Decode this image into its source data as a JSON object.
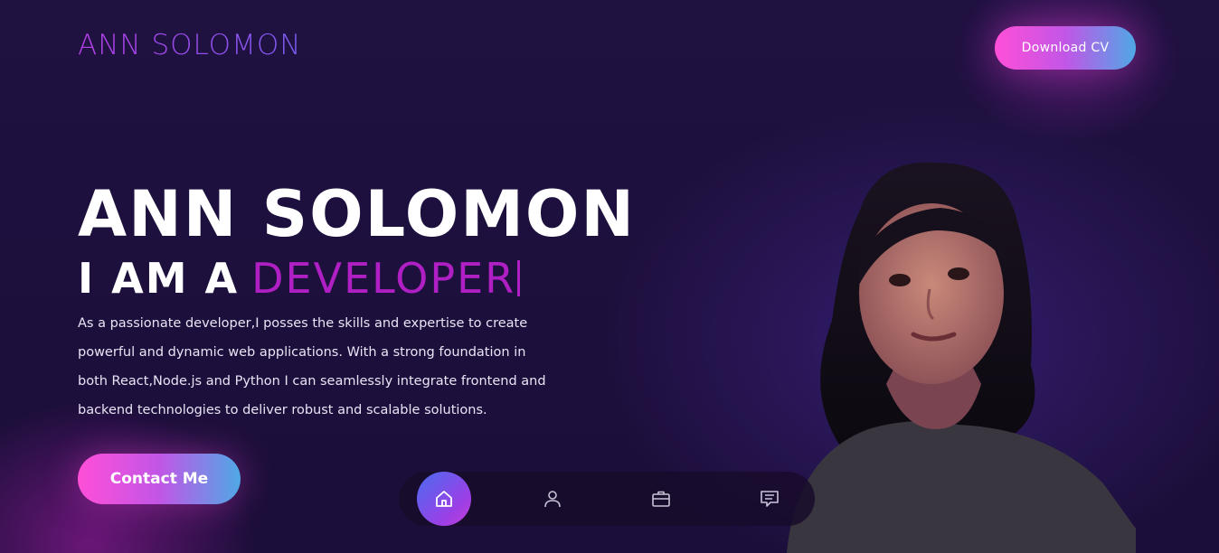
{
  "header": {
    "logo": "ANN SOLOMON",
    "download_label": "Download CV"
  },
  "hero": {
    "name": "ANN SOLOMON",
    "intro": "I AM A",
    "role": "DEVELOPER",
    "description": "As a passionate developer,I posses the skills and expertise to create powerful and dynamic web applications. With a strong foundation in both React,Node.js and Python I can seamlessly integrate frontend and backend technologies to deliver robust and scalable solutions.",
    "contact_label": "Contact Me"
  },
  "bottom_nav": {
    "items": [
      {
        "icon": "home-icon",
        "active": true
      },
      {
        "icon": "user-icon",
        "active": false
      },
      {
        "icon": "briefcase-icon",
        "active": false
      },
      {
        "icon": "chat-icon",
        "active": false
      }
    ]
  },
  "colors": {
    "background": "#1d0f3d",
    "accent_purple": "#b01fc4",
    "gradient_start": "#ff4fd8",
    "gradient_end": "#4fa8e6"
  }
}
